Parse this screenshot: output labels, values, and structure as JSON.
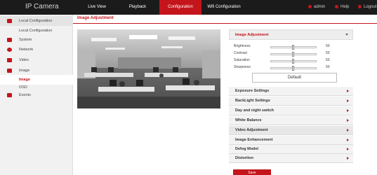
{
  "topbar": {
    "brand": "IP Camera",
    "nav": [
      "Live View",
      "Playback",
      "Configuration",
      "Wifi Configuration"
    ],
    "right": [
      "admin",
      "Help",
      "Logout"
    ]
  },
  "sidebar": {
    "items": [
      {
        "label": "Local Configuration",
        "icon": "monitor-icon"
      },
      {
        "label": "Local Configuration"
      },
      {
        "label": "System",
        "icon": "system-icon"
      },
      {
        "label": "Network",
        "icon": "network-icon"
      },
      {
        "label": "Video",
        "icon": "video-icon"
      },
      {
        "label": "Image",
        "icon": "image-icon"
      },
      {
        "label": "Image"
      },
      {
        "label": "OSD"
      },
      {
        "label": "Events",
        "icon": "events-icon"
      }
    ]
  },
  "tab": "Image Adjustment",
  "panel": {
    "title": "Image Adjustment",
    "sliders": [
      {
        "label": "Brightness",
        "value": "50",
        "fraction": 0.5
      },
      {
        "label": "Contrast",
        "value": "50",
        "fraction": 0.5
      },
      {
        "label": "Saturation",
        "value": "50",
        "fraction": 0.5
      },
      {
        "label": "Sharpness",
        "value": "50",
        "fraction": 0.5
      }
    ],
    "default_label": "Default"
  },
  "sections": [
    "Exposure Settings",
    "BackLight Settings",
    "Day and night switch",
    "White Balance",
    "Video Adjustment",
    "Image Enhancement",
    "Defog Model",
    "Distortion"
  ],
  "save_label": "Save",
  "colors": {
    "accent": "#c4151c",
    "topbar": "#1b1b1b"
  }
}
